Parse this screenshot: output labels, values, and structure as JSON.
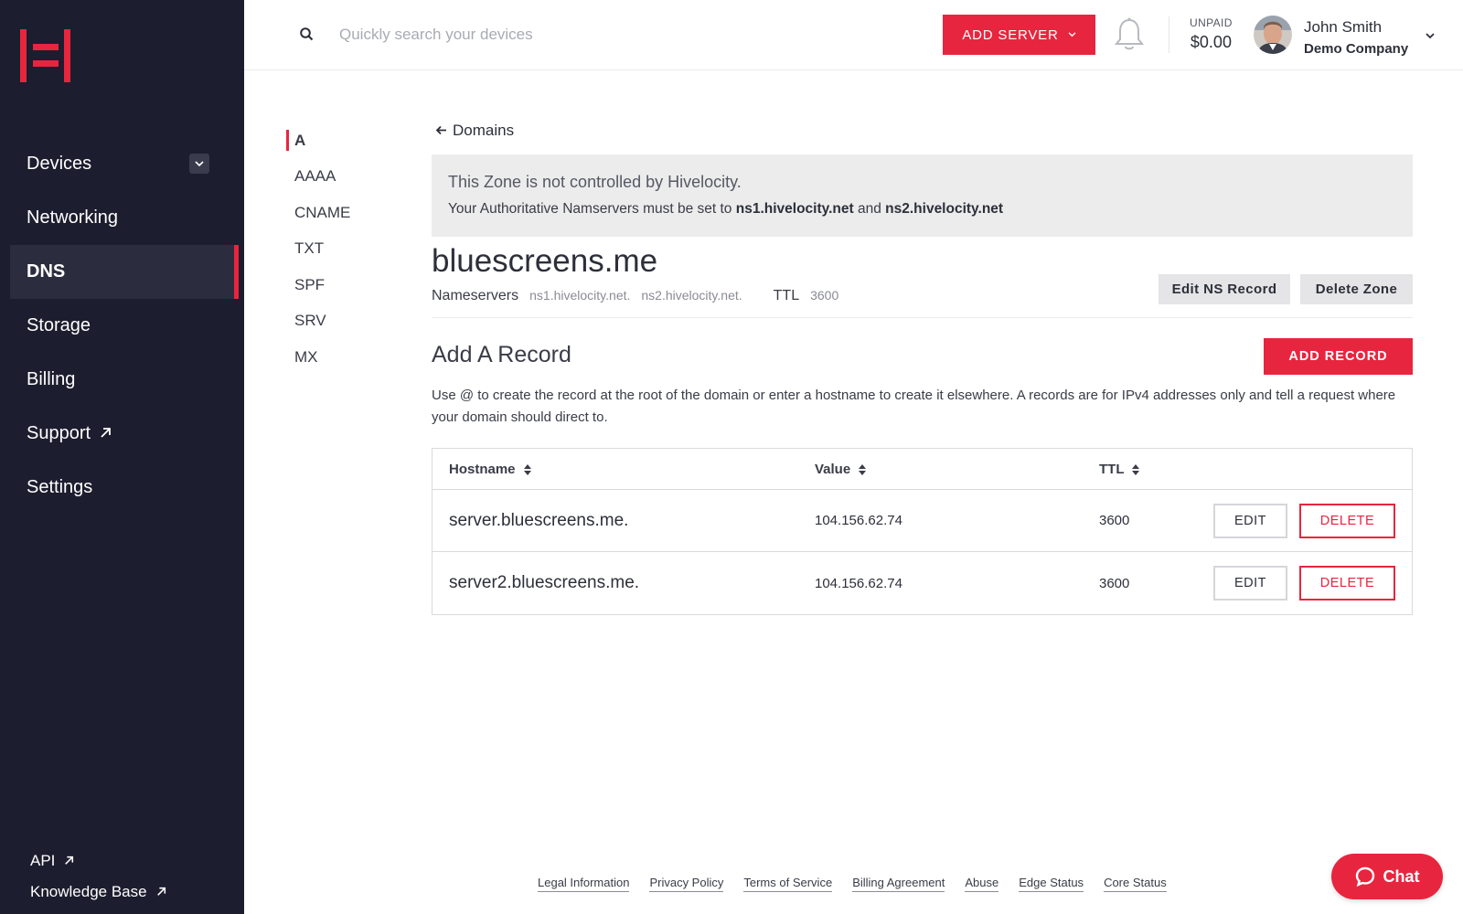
{
  "sidebar": {
    "logo": "hivelocity-logo",
    "items": [
      {
        "label": "Devices",
        "name": "devices",
        "has_toggle": true
      },
      {
        "label": "Networking",
        "name": "networking"
      },
      {
        "label": "DNS",
        "name": "dns",
        "active": true
      },
      {
        "label": "Storage",
        "name": "storage"
      },
      {
        "label": "Billing",
        "name": "billing"
      },
      {
        "label": "Support",
        "name": "support",
        "external": true
      },
      {
        "label": "Settings",
        "name": "settings"
      }
    ],
    "bottom_links": [
      {
        "label": "API",
        "external": true
      },
      {
        "label": "Knowledge Base",
        "external": true
      }
    ]
  },
  "header": {
    "search_placeholder": "Quickly search your devices",
    "add_server_label": "ADD SERVER",
    "balance_label": "UNPAID",
    "balance_value": "$0.00",
    "user_name": "John Smith",
    "user_company": "Demo Company"
  },
  "record_types": [
    "A",
    "AAAA",
    "CNAME",
    "TXT",
    "SPF",
    "SRV",
    "MX"
  ],
  "active_record_type": "A",
  "main": {
    "back_label": "Domains",
    "notice_title": "This Zone is not controlled by Hivelocity.",
    "notice_prefix": "Your Authoritative Namservers must be set to ",
    "notice_ns1": "ns1.hivelocity.net",
    "notice_and": " and ",
    "notice_ns2": "ns2.hivelocity.net",
    "domain": "bluescreens.me",
    "nameservers_label": "Nameservers",
    "nameservers": [
      "ns1.hivelocity.net.",
      "ns2.hivelocity.net."
    ],
    "ttl_label": "TTL",
    "ttl_value": "3600",
    "edit_ns_label": "Edit NS Record",
    "delete_zone_label": "Delete Zone",
    "section_title": "Add A Record",
    "add_record_label": "ADD RECORD",
    "section_desc": "Use @ to create the record at the root of the domain or enter a hostname to create it elsewhere. A records are for IPv4 addresses only and tell a request where your domain should direct to."
  },
  "table": {
    "columns": [
      "Hostname",
      "Value",
      "TTL"
    ],
    "edit_label": "EDIT",
    "delete_label": "DELETE",
    "rows": [
      {
        "hostname": "server.bluescreens.me.",
        "value": "104.156.62.74",
        "ttl": "3600"
      },
      {
        "hostname": "server2.bluescreens.me.",
        "value": "104.156.62.74",
        "ttl": "3600"
      }
    ]
  },
  "footer": {
    "links": [
      "Legal Information",
      "Privacy Policy",
      "Terms of Service",
      "Billing Agreement",
      "Abuse",
      "Edge Status",
      "Core Status"
    ]
  },
  "chat_label": "Chat",
  "colors": {
    "accent": "#e8253e",
    "sidebar_bg": "#1c1d2e",
    "sidebar_active_bg": "#2b2d3e",
    "notice_bg": "#ececec"
  }
}
